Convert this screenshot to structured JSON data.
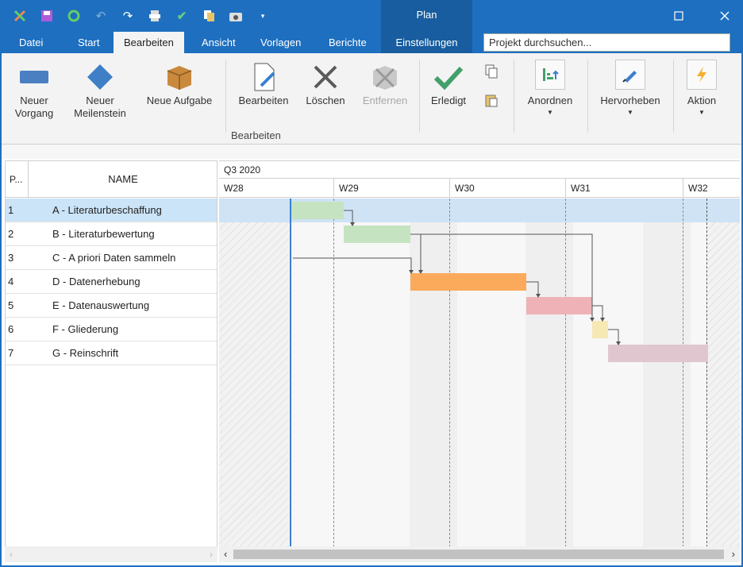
{
  "window": {
    "context_tab": "Plan",
    "controls": [
      "restore",
      "close"
    ]
  },
  "quick_access": [
    "app-icon",
    "save-icon",
    "refresh-icon",
    "undo-icon",
    "redo-icon",
    "print-icon",
    "check-icon",
    "copy-icon",
    "camera-icon",
    "customize-icon"
  ],
  "tabs": [
    "Datei",
    "Start",
    "Bearbeiten",
    "Ansicht",
    "Vorlagen",
    "Berichte",
    "Einstellungen"
  ],
  "active_tab": "Bearbeiten",
  "search": {
    "placeholder": "Projekt durchsuchen..."
  },
  "ribbon": {
    "buttons": {
      "neuer_vorgang": {
        "line1": "Neuer",
        "line2": "Vorgang"
      },
      "neuer_meilenstein": {
        "line1": "Neuer",
        "line2": "Meilenstein"
      },
      "neue_aufgabe": "Neue Aufgabe",
      "bearbeiten": "Bearbeiten",
      "loeschen": "Löschen",
      "entfernen": "Entfernen",
      "erledigt": "Erledigt",
      "anordnen": "Anordnen",
      "hervorheben": "Hervorheben",
      "aktion": "Aktion"
    },
    "group_label": "Bearbeiten"
  },
  "grid": {
    "col_pos": "P...",
    "col_name": "NAME",
    "rows": [
      {
        "n": "1",
        "name": "A - Literaturbeschaffung"
      },
      {
        "n": "2",
        "name": "B - Literaturbewertung"
      },
      {
        "n": "3",
        "name": "C - A priori Daten sammeln"
      },
      {
        "n": "4",
        "name": "D - Datenerhebung"
      },
      {
        "n": "5",
        "name": "E - Datenauswertung"
      },
      {
        "n": "6",
        "name": "F - Gliederung"
      },
      {
        "n": "7",
        "name": "G - Reinschrift"
      }
    ],
    "selected_row": 1
  },
  "gantt": {
    "quarter": "Q3 2020",
    "weeks": [
      "W28",
      "W29",
      "W30",
      "W31",
      "W32"
    ],
    "colors": {
      "A": "#c5e3c0",
      "B": "#c5e3c0",
      "D": "#fbaa5c",
      "E": "#efb2b7",
      "F": "#f6e9b3",
      "G": "#dfc6cf"
    }
  }
}
